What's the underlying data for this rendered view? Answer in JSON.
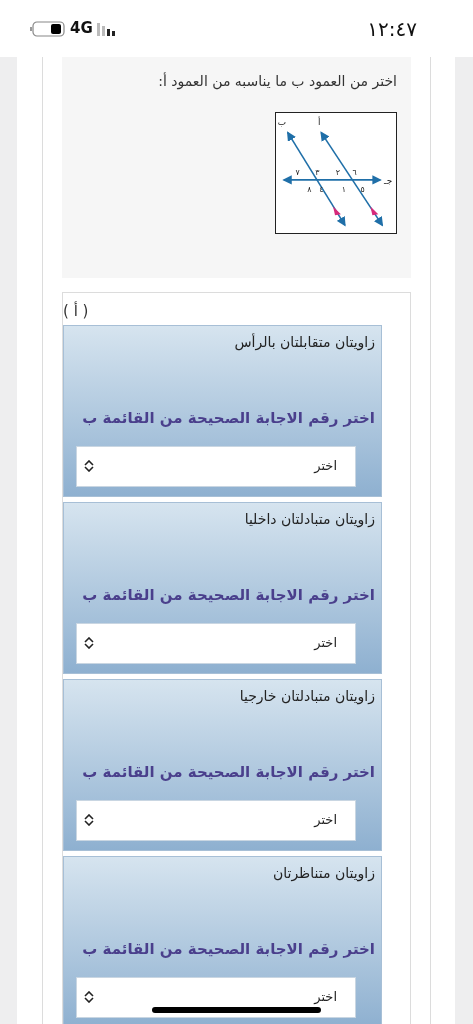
{
  "status_bar": {
    "time": "١٢:٤٧",
    "network": "4G"
  },
  "question": {
    "prompt": "اختر من العمود ب ما يناسبه من العمود أ:",
    "figure": {
      "line_labels": [
        "ب",
        "أ",
        "جـ"
      ],
      "angle_labels": [
        "٦",
        "٢",
        "٣",
        "٧",
        "٥",
        "١",
        "٤",
        "٨"
      ]
    }
  },
  "column_a": {
    "label": "( أ )",
    "items": [
      {
        "text": "زاويتان متقابلتان بالرأس",
        "instruction": "اختر رقم الاجابة الصحيحة من القائمة ب",
        "select_value": "اختر"
      },
      {
        "text": "زاويتان متبادلتان داخليا",
        "instruction": "اختر رقم الاجابة الصحيحة من القائمة ب",
        "select_value": "اختر"
      },
      {
        "text": "زاويتان متبادلتان خارجيا",
        "instruction": "اختر رقم الاجابة الصحيحة من القائمة ب",
        "select_value": "اختر"
      },
      {
        "text": "زاويتان متناظرتان",
        "instruction": "اختر رقم الاجابة الصحيحة من القائمة ب",
        "select_value": "اختر"
      }
    ]
  }
}
